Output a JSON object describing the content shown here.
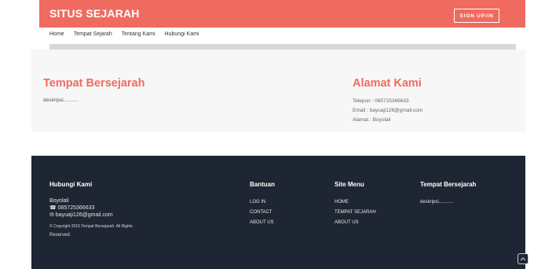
{
  "header": {
    "brand": "SITUS SEJARAH",
    "signup_label": "SIGN UP/IN"
  },
  "nav": {
    "items": [
      {
        "label": "Home"
      },
      {
        "label": "Tempat Sejarah"
      },
      {
        "label": "Tentang Kami"
      },
      {
        "label": "Hubungi Kami"
      }
    ]
  },
  "main": {
    "left": {
      "title": "Tempat Bersejarah",
      "description": "deskripsi..........."
    },
    "right": {
      "title": "Alamat Kami",
      "phone": "Telepon : 085725366633",
      "email": "Email : bayuaji126@gmail.com",
      "address": "Alamat : Boyolali"
    }
  },
  "footer": {
    "contact": {
      "title": "Hubungi Kami",
      "city": "Boyolali",
      "phone": "☎ 085725366633",
      "email": "✉ bayuaji126@gmail.com",
      "copyright_line1": "© Copyright 2016 Tempat Bersejarah. All Rights",
      "copyright_line2": "Reserved"
    },
    "help": {
      "title": "Bantuan",
      "links": [
        "LOG IN",
        "CONTACT",
        "ABOUT US"
      ]
    },
    "site_menu": {
      "title": "Site Menu",
      "links": [
        "HOME",
        "TEMPAT SEJARAH",
        "ABOUT US"
      ]
    },
    "places": {
      "title": "Tempat Bersejarah",
      "description": "deskripsi..........."
    }
  },
  "colors": {
    "accent": "#f06b5f",
    "footer_bg": "#1d2632",
    "content_bg": "#f7f7f7"
  },
  "icons": {
    "scroll_top": "chevron-up-icon"
  }
}
